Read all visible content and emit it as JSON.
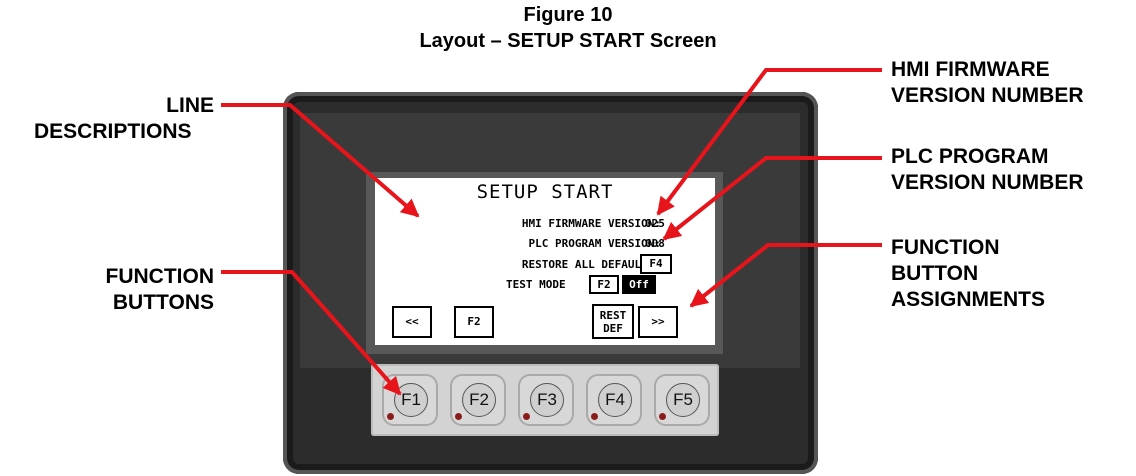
{
  "figure": {
    "number": "Figure 10",
    "caption": "Layout – SETUP START Screen"
  },
  "callouts": {
    "line_descriptions": [
      "LINE",
      "DESCRIPTIONS"
    ],
    "function_buttons": [
      "FUNCTION",
      "BUTTONS"
    ],
    "hmi_firmware": [
      "HMI FIRMWARE",
      "VERSION NUMBER"
    ],
    "plc_program": [
      "PLC PROGRAM",
      "VERSION NUMBER"
    ],
    "function_assignments": [
      "FUNCTION",
      "BUTTON",
      "ASSIGNMENTS"
    ]
  },
  "screen": {
    "title": "SETUP START",
    "hmi_firmware_label": "HMI FIRMWARE VERSION:",
    "hmi_firmware_value": "025",
    "plc_program_label": "PLC PROGRAM VERSION:",
    "plc_program_value": "008",
    "restore_label": "RESTORE ALL DEFAULTS:",
    "restore_key": "F4",
    "test_mode_label": "TEST MODE",
    "test_mode_key": "F2",
    "test_mode_value": "Off",
    "softkeys": {
      "prev": "<<",
      "f2": "F2",
      "rest_line1": "REST",
      "rest_line2": "DEF",
      "next": ">>"
    }
  },
  "keypad": {
    "keys": [
      "F1",
      "F2",
      "F3",
      "F4",
      "F5"
    ]
  },
  "colors": {
    "arrow": "#e8141b",
    "bezel": "#2c2c2c",
    "keypad": "#d3d3d3"
  }
}
